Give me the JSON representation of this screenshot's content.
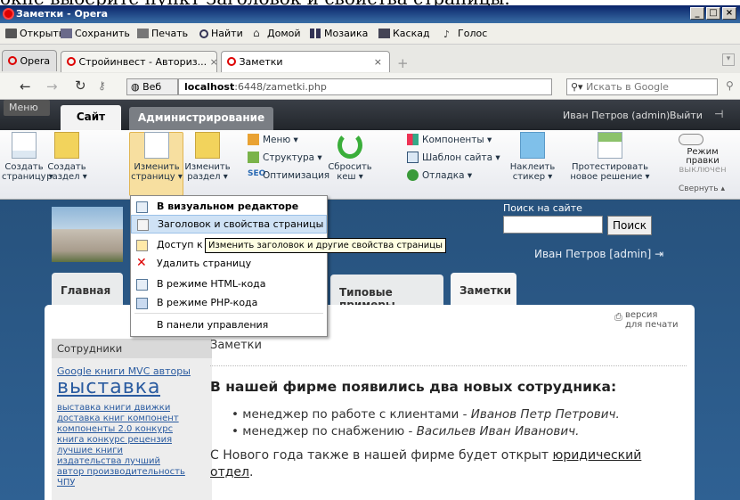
{
  "window": {
    "title": "Заметки - Opera"
  },
  "menubar": [
    "Открыть",
    "Сохранить",
    "Печать",
    "Найти",
    "Домой",
    "Мозаика",
    "Каскад",
    "Голос"
  ],
  "tabs": [
    {
      "label": "Opera"
    },
    {
      "label": "Стройинвест - Авториз..."
    },
    {
      "label": "Заметки"
    }
  ],
  "address": {
    "prefix": "Веб",
    "url_host": "localhost",
    "url_rest": ":6448/zametki.php",
    "search_placeholder": "Искать в Google"
  },
  "ribbon_head": {
    "menu": "Меню",
    "tab_site": "Сайт",
    "tab_admin": "Администрирование",
    "user": "Иван Петров (admin)",
    "logout": "Выйти"
  },
  "ribbon": {
    "create_page": [
      "Создать",
      "страницу ▾"
    ],
    "create_section": [
      "Создать",
      "раздел ▾"
    ],
    "edit_page": [
      "Изменить",
      "страницу ▾"
    ],
    "edit_section": [
      "Изменить",
      "раздел ▾"
    ],
    "menu": "Меню ▾",
    "structure": "Структура ▾",
    "optimize": "Оптимизация",
    "reset_cache": [
      "Сбросить",
      "кеш ▾"
    ],
    "components": "Компоненты ▾",
    "template": "Шаблон сайта ▾",
    "debug": "Отладка ▾",
    "sticker": [
      "Наклеить",
      "стикер ▾"
    ],
    "test": [
      "Протестировать",
      "новое решение ▾"
    ],
    "edit_mode": [
      "Режим правки",
      "выключен"
    ],
    "collapse": "Свернуть ▴"
  },
  "dropdown": [
    "В визуальном редакторе",
    "Заголовок и свойства страницы",
    "Доступ к",
    "Удалить страницу",
    "В режиме HTML-кода",
    "В режиме PHP-кода",
    "В панели управления"
  ],
  "tooltip": "Изменить заголовок и другие свойства страницы",
  "site": {
    "search_label": "Поиск на сайте",
    "search_button": "Поиск",
    "user": "Иван Петров [admin] ⇥",
    "nav": [
      "Главная",
      "Типовые примеры",
      "Заметки"
    ],
    "print": [
      "версия",
      "для печати"
    ],
    "sidebar_title": "Сотрудники",
    "tags": [
      "Google книги MVC авторы",
      "выставка",
      "выставка книги движки",
      "доставка книг компонент",
      "компоненты 2.0 конкурс",
      "книга конкурс рецензия",
      "лучшие книги",
      "издательства лучший",
      "автор производительность",
      "ЧПУ"
    ],
    "page_title": "Заметки",
    "heading": "В нашей фирме появились два новых сотрудника:",
    "items": [
      {
        "text": "менеджер по работе с клиентами - ",
        "name": "Иванов Петр Петрович."
      },
      {
        "text": "менеджер по снабжению - ",
        "name": "Васильев Иван Иванович."
      }
    ],
    "para_text": "С Нового года также в нашей фирме будет открыт ",
    "para_link": "юридический отдел",
    "para_end": "."
  },
  "top_caption": "окне выберите пункт Заголовок и свойства страницы."
}
